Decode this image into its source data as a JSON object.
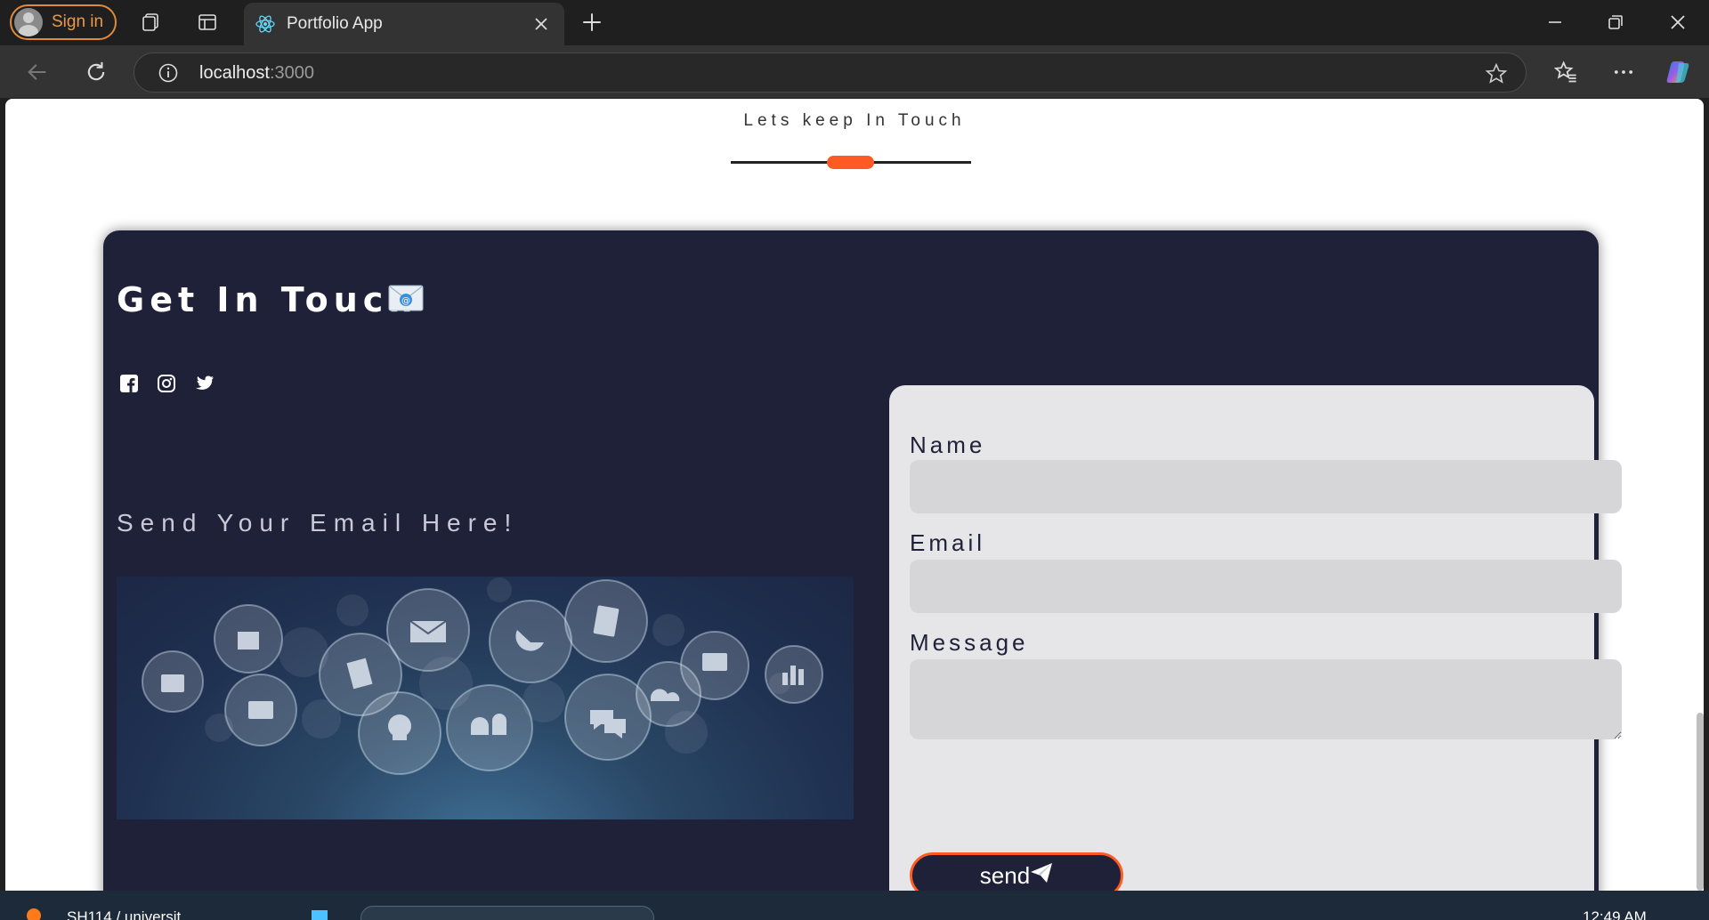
{
  "browser": {
    "signin_label": "Sign in",
    "tab_title": "Portfolio App",
    "url_host": "localhost",
    "url_port": ":3000"
  },
  "page": {
    "section_heading": "Lets keep In Touch",
    "card_title": "Get In Touch",
    "send_here": "Send Your Email Here!",
    "accent_color": "#ff5a23",
    "card_color": "#1e2137"
  },
  "form": {
    "name_label": "Name",
    "email_label": "Email",
    "message_label": "Message",
    "name_value": "",
    "email_value": "",
    "message_value": "",
    "send_label": "send"
  },
  "taskbar": {
    "window_label": "SH114 / universit",
    "clock": "12:49 AM"
  },
  "icons": [
    "profile-icon",
    "workspaces-icon",
    "tab-actions-icon",
    "react-icon",
    "close-tab-icon",
    "new-tab-icon",
    "minimize-icon",
    "restore-icon",
    "close-window-icon",
    "back-icon",
    "refresh-icon",
    "info-icon",
    "favorite-star-icon",
    "favorites-icon",
    "more-icon",
    "copilot-icon",
    "envelope-icon",
    "facebook-icon",
    "instagram-icon",
    "twitter-icon",
    "paper-plane-icon"
  ]
}
